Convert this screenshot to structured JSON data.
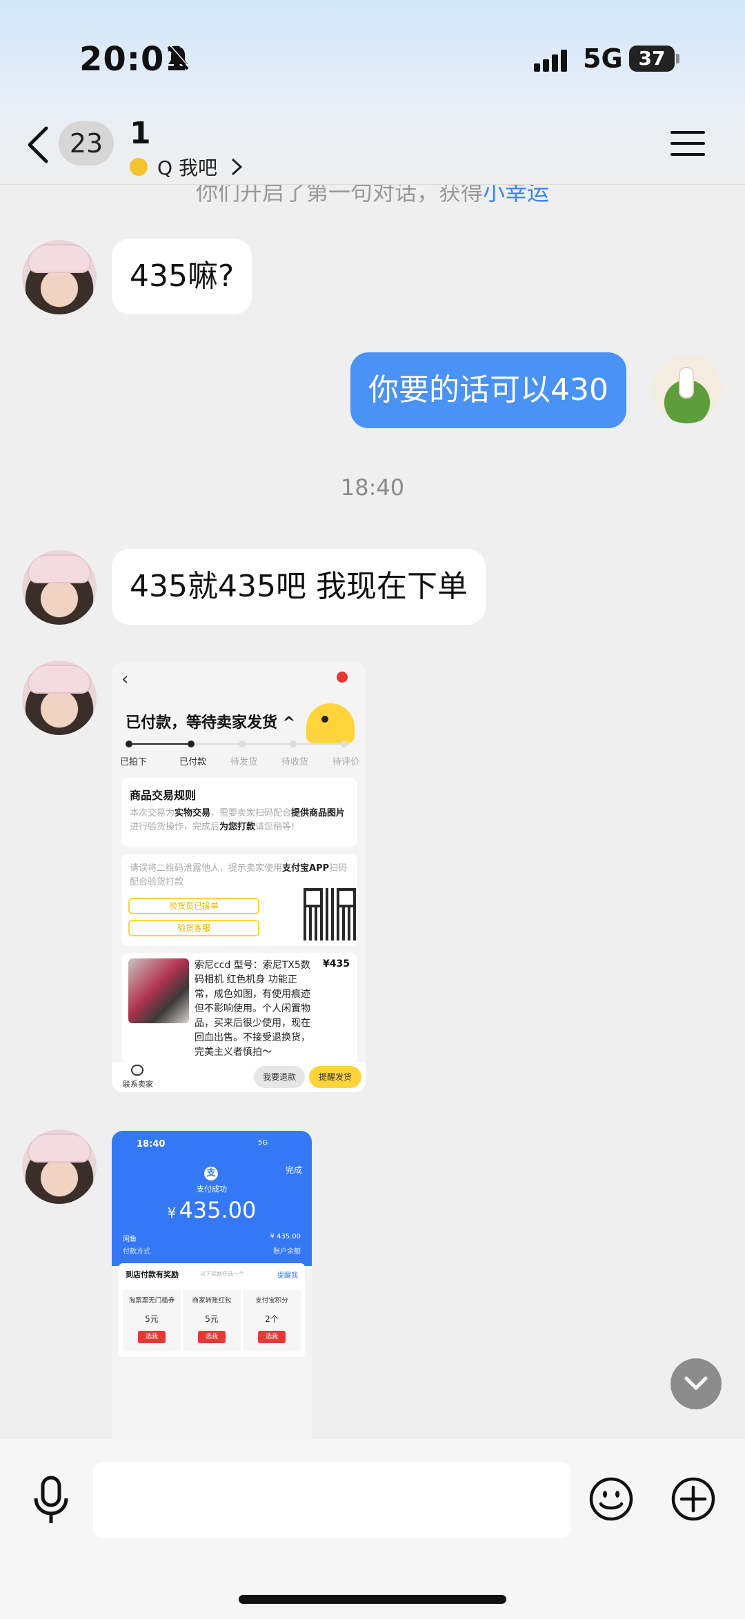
{
  "status": {
    "time": "20:01",
    "network": "5G",
    "battery": "37"
  },
  "header": {
    "unread_count": "23",
    "name": "1",
    "subtitle": "Q 我吧"
  },
  "notice_partial": {
    "before": "你们开启了第一句对话，获得",
    "highlight": "小幸运"
  },
  "messages": [
    {
      "side": "left",
      "text": "435嘛?"
    },
    {
      "side": "right",
      "text": "你要的话可以430"
    },
    {
      "type": "time",
      "text": "18:40"
    },
    {
      "side": "left",
      "text": "435就435吧 我现在下单"
    }
  ],
  "order_screenshot": {
    "title": "已付款，等待卖家发货 ^",
    "steps": [
      "已拍下",
      "已付款",
      "待发货",
      "待收货",
      "待评价"
    ],
    "rules_title": "商品交易规则",
    "rules_body_1": "本次交易为",
    "rules_body_2": "实物交易",
    "rules_body_3": "，需要卖家扫码配合",
    "rules_body_4": "提供商品图片",
    "rules_body_5": "进行验货操作，完成后",
    "rules_body_6": "为您打款",
    "rules_body_7": "请您稍等!",
    "qr_text_1": "请误将二维码泄露他人，提示卖家使用",
    "qr_text_2": "支付宝APP",
    "qr_text_3": "扫码配合验货打款",
    "pill_1": "验货员已接单",
    "pill_2": "验货客服",
    "item_desc": "索尼ccd 型号：索尼TX5数码相机 红色机身 功能正常，成色如图，有使用痕迹但不影响使用。个人闲置物品，买来后很少使用，现在回血出售。不接受退换货，完美主义者慎拍～",
    "item_price": "¥435",
    "contact_seller": "联系卖家",
    "refund_button": "我要退款",
    "remind_button": "提醒发货"
  },
  "payment_screenshot": {
    "time": "18:40",
    "signal": "5G",
    "done": "完成",
    "status": "支付成功",
    "currency": "¥",
    "amount": "435.00",
    "merchant": "闲鱼",
    "merchant_amount": "¥ 435.00",
    "pay_method_label": "付款方式",
    "pay_method": "账户余额",
    "reward_title": "到店付款有奖励",
    "reward_sub": "以下奖励任选一个",
    "reward_link": "提醒我",
    "rewards": [
      {
        "name": "淘票票无门槛券",
        "value": "5元",
        "button": "选我"
      },
      {
        "name": "商家转账红包",
        "value": "5元",
        "button": "选我"
      },
      {
        "name": "支付宝积分",
        "value": "2个",
        "button": "选我"
      }
    ]
  },
  "input": {
    "placeholder": ""
  },
  "colors": {
    "my_bubble": "#4a92f4",
    "payment_blue": "#3478f6",
    "xianyu_yellow": "#ffd43b"
  }
}
